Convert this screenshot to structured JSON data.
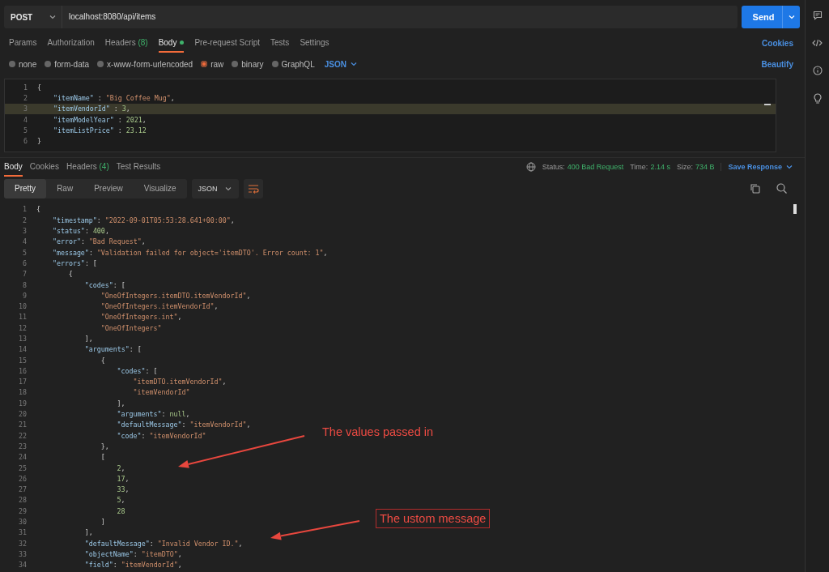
{
  "request": {
    "method": "POST",
    "url": "localhost:8080/api/items",
    "send": "Send"
  },
  "request_tabs": [
    {
      "label": "Params",
      "dot": false,
      "selected": false
    },
    {
      "label": "Authorization",
      "dot": false,
      "selected": false
    },
    {
      "label": "Headers",
      "count": "(8)",
      "dot": false,
      "selected": false
    },
    {
      "label": "Body",
      "dot": true,
      "selected": true
    },
    {
      "label": "Pre-request Script",
      "dot": false,
      "selected": false
    },
    {
      "label": "Tests",
      "dot": false,
      "selected": false
    },
    {
      "label": "Settings",
      "dot": false,
      "selected": false
    }
  ],
  "cookies_link": "Cookies",
  "body_types": [
    {
      "label": "none",
      "selected": false
    },
    {
      "label": "form-data",
      "selected": false
    },
    {
      "label": "x-www-form-urlencoded",
      "selected": false
    },
    {
      "label": "raw",
      "selected": true
    },
    {
      "label": "binary",
      "selected": false
    },
    {
      "label": "GraphQL",
      "selected": false
    }
  ],
  "body_language": "JSON",
  "beautify": "Beautify",
  "request_body": [
    {
      "number": "1",
      "highlighted": false,
      "tokens": [
        {
          "kind": "punct",
          "text": "{"
        }
      ]
    },
    {
      "number": "2",
      "highlighted": false,
      "tokens": [
        {
          "kind": "key",
          "text": "    \"itemName\""
        },
        {
          "kind": "punct",
          "text": " : "
        },
        {
          "kind": "string",
          "text": "\"Big Coffee Mug\""
        },
        {
          "kind": "punct",
          "text": ","
        }
      ]
    },
    {
      "number": "3",
      "highlighted": true,
      "tokens": [
        {
          "kind": "key",
          "text": "    \"itemVendorId\""
        },
        {
          "kind": "punct",
          "text": " : "
        },
        {
          "kind": "number",
          "text": "3"
        },
        {
          "kind": "punct",
          "text": ","
        }
      ]
    },
    {
      "number": "4",
      "highlighted": false,
      "tokens": [
        {
          "kind": "key",
          "text": "    \"itemModelYear\""
        },
        {
          "kind": "punct",
          "text": " : "
        },
        {
          "kind": "number",
          "text": "2021"
        },
        {
          "kind": "punct",
          "text": ","
        }
      ]
    },
    {
      "number": "5",
      "highlighted": false,
      "tokens": [
        {
          "kind": "key",
          "text": "    \"itemListPrice\""
        },
        {
          "kind": "punct",
          "text": " : "
        },
        {
          "kind": "number",
          "text": "23.12"
        }
      ]
    },
    {
      "number": "6",
      "highlighted": false,
      "tokens": [
        {
          "kind": "punct",
          "text": "}"
        }
      ]
    }
  ],
  "response_tabs": [
    {
      "label": "Body",
      "selected": true
    },
    {
      "label": "Cookies",
      "selected": false
    },
    {
      "label": "Headers",
      "count": "(4)",
      "selected": false
    },
    {
      "label": "Test Results",
      "selected": false
    }
  ],
  "response_meta": {
    "status_label": "Status:",
    "status": "400 Bad Request",
    "time_label": "Time:",
    "time": "2.14 s",
    "size_label": "Size:",
    "size": "734 B",
    "save": "Save Response"
  },
  "view_modes": [
    {
      "label": "Pretty",
      "selected": true
    },
    {
      "label": "Raw",
      "selected": false
    },
    {
      "label": "Preview",
      "selected": false
    },
    {
      "label": "Visualize",
      "selected": false
    }
  ],
  "response_format": "JSON",
  "response_body": [
    {
      "number": "1",
      "tokens": [
        {
          "kind": "punct",
          "text": "{"
        }
      ]
    },
    {
      "number": "2",
      "tokens": [
        {
          "kind": "key",
          "text": "    \"timestamp\""
        },
        {
          "kind": "punct",
          "text": ": "
        },
        {
          "kind": "string",
          "text": "\"2022-09-01T05:53:28.641+00:00\""
        },
        {
          "kind": "punct",
          "text": ","
        }
      ]
    },
    {
      "number": "3",
      "tokens": [
        {
          "kind": "key",
          "text": "    \"status\""
        },
        {
          "kind": "punct",
          "text": ": "
        },
        {
          "kind": "number",
          "text": "400"
        },
        {
          "kind": "punct",
          "text": ","
        }
      ]
    },
    {
      "number": "4",
      "tokens": [
        {
          "kind": "key",
          "text": "    \"error\""
        },
        {
          "kind": "punct",
          "text": ": "
        },
        {
          "kind": "string",
          "text": "\"Bad Request\""
        },
        {
          "kind": "punct",
          "text": ","
        }
      ]
    },
    {
      "number": "5",
      "tokens": [
        {
          "kind": "key",
          "text": "    \"message\""
        },
        {
          "kind": "punct",
          "text": ": "
        },
        {
          "kind": "string",
          "text": "\"Validation failed for object='itemDTO'. Error count: 1\""
        },
        {
          "kind": "punct",
          "text": ","
        }
      ]
    },
    {
      "number": "6",
      "tokens": [
        {
          "kind": "key",
          "text": "    \"errors\""
        },
        {
          "kind": "punct",
          "text": ": ["
        }
      ]
    },
    {
      "number": "7",
      "tokens": [
        {
          "kind": "punct",
          "text": "        {"
        }
      ]
    },
    {
      "number": "8",
      "tokens": [
        {
          "kind": "key",
          "text": "            \"codes\""
        },
        {
          "kind": "punct",
          "text": ": ["
        }
      ]
    },
    {
      "number": "9",
      "tokens": [
        {
          "kind": "string",
          "text": "                \"OneOfIntegers.itemDTO.itemVendorId\""
        },
        {
          "kind": "punct",
          "text": ","
        }
      ]
    },
    {
      "number": "10",
      "tokens": [
        {
          "kind": "string",
          "text": "                \"OneOfIntegers.itemVendorId\""
        },
        {
          "kind": "punct",
          "text": ","
        }
      ]
    },
    {
      "number": "11",
      "tokens": [
        {
          "kind": "string",
          "text": "                \"OneOfIntegers.int\""
        },
        {
          "kind": "punct",
          "text": ","
        }
      ]
    },
    {
      "number": "12",
      "tokens": [
        {
          "kind": "string",
          "text": "                \"OneOfIntegers\""
        }
      ]
    },
    {
      "number": "13",
      "tokens": [
        {
          "kind": "punct",
          "text": "            ],"
        }
      ]
    },
    {
      "number": "14",
      "tokens": [
        {
          "kind": "key",
          "text": "            \"arguments\""
        },
        {
          "kind": "punct",
          "text": ": ["
        }
      ]
    },
    {
      "number": "15",
      "tokens": [
        {
          "kind": "punct",
          "text": "                {"
        }
      ]
    },
    {
      "number": "16",
      "tokens": [
        {
          "kind": "key",
          "text": "                    \"codes\""
        },
        {
          "kind": "punct",
          "text": ": ["
        }
      ]
    },
    {
      "number": "17",
      "tokens": [
        {
          "kind": "string",
          "text": "                        \"itemDTO.itemVendorId\""
        },
        {
          "kind": "punct",
          "text": ","
        }
      ]
    },
    {
      "number": "18",
      "tokens": [
        {
          "kind": "string",
          "text": "                        \"itemVendorId\""
        }
      ]
    },
    {
      "number": "19",
      "tokens": [
        {
          "kind": "punct",
          "text": "                    ],"
        }
      ]
    },
    {
      "number": "20",
      "tokens": [
        {
          "kind": "key",
          "text": "                    \"arguments\""
        },
        {
          "kind": "punct",
          "text": ": "
        },
        {
          "kind": "number",
          "text": "null"
        },
        {
          "kind": "punct",
          "text": ","
        }
      ]
    },
    {
      "number": "21",
      "tokens": [
        {
          "kind": "key",
          "text": "                    \"defaultMessage\""
        },
        {
          "kind": "punct",
          "text": ": "
        },
        {
          "kind": "string",
          "text": "\"itemVendorId\""
        },
        {
          "kind": "punct",
          "text": ","
        }
      ]
    },
    {
      "number": "22",
      "tokens": [
        {
          "kind": "key",
          "text": "                    \"code\""
        },
        {
          "kind": "punct",
          "text": ": "
        },
        {
          "kind": "string",
          "text": "\"itemVendorId\""
        }
      ]
    },
    {
      "number": "23",
      "tokens": [
        {
          "kind": "punct",
          "text": "                },"
        }
      ]
    },
    {
      "number": "24",
      "tokens": [
        {
          "kind": "punct",
          "text": "                ["
        }
      ]
    },
    {
      "number": "25",
      "tokens": [
        {
          "kind": "number",
          "text": "                    2"
        },
        {
          "kind": "punct",
          "text": ","
        }
      ]
    },
    {
      "number": "26",
      "tokens": [
        {
          "kind": "number",
          "text": "                    17"
        },
        {
          "kind": "punct",
          "text": ","
        }
      ]
    },
    {
      "number": "27",
      "tokens": [
        {
          "kind": "number",
          "text": "                    33"
        },
        {
          "kind": "punct",
          "text": ","
        }
      ]
    },
    {
      "number": "28",
      "tokens": [
        {
          "kind": "number",
          "text": "                    5"
        },
        {
          "kind": "punct",
          "text": ","
        }
      ]
    },
    {
      "number": "29",
      "tokens": [
        {
          "kind": "number",
          "text": "                    28"
        }
      ]
    },
    {
      "number": "30",
      "tokens": [
        {
          "kind": "punct",
          "text": "                ]"
        }
      ]
    },
    {
      "number": "31",
      "tokens": [
        {
          "kind": "punct",
          "text": "            ],"
        }
      ]
    },
    {
      "number": "32",
      "tokens": [
        {
          "kind": "key",
          "text": "            \"defaultMessage\""
        },
        {
          "kind": "punct",
          "text": ": "
        },
        {
          "kind": "string",
          "text": "\"Invalid Vendor ID.\""
        },
        {
          "kind": "punct",
          "text": ","
        }
      ]
    },
    {
      "number": "33",
      "tokens": [
        {
          "kind": "key",
          "text": "            \"objectName\""
        },
        {
          "kind": "punct",
          "text": ": "
        },
        {
          "kind": "string",
          "text": "\"itemDTO\""
        },
        {
          "kind": "punct",
          "text": ","
        }
      ]
    },
    {
      "number": "34",
      "tokens": [
        {
          "kind": "key",
          "text": "            \"field\""
        },
        {
          "kind": "punct",
          "text": ": "
        },
        {
          "kind": "string",
          "text": "\"itemVendorId\""
        },
        {
          "kind": "punct",
          "text": ","
        }
      ]
    }
  ],
  "annotations": [
    {
      "text": "The values passed in",
      "boxed": false
    },
    {
      "text": "The ustom message",
      "boxed": true
    }
  ]
}
